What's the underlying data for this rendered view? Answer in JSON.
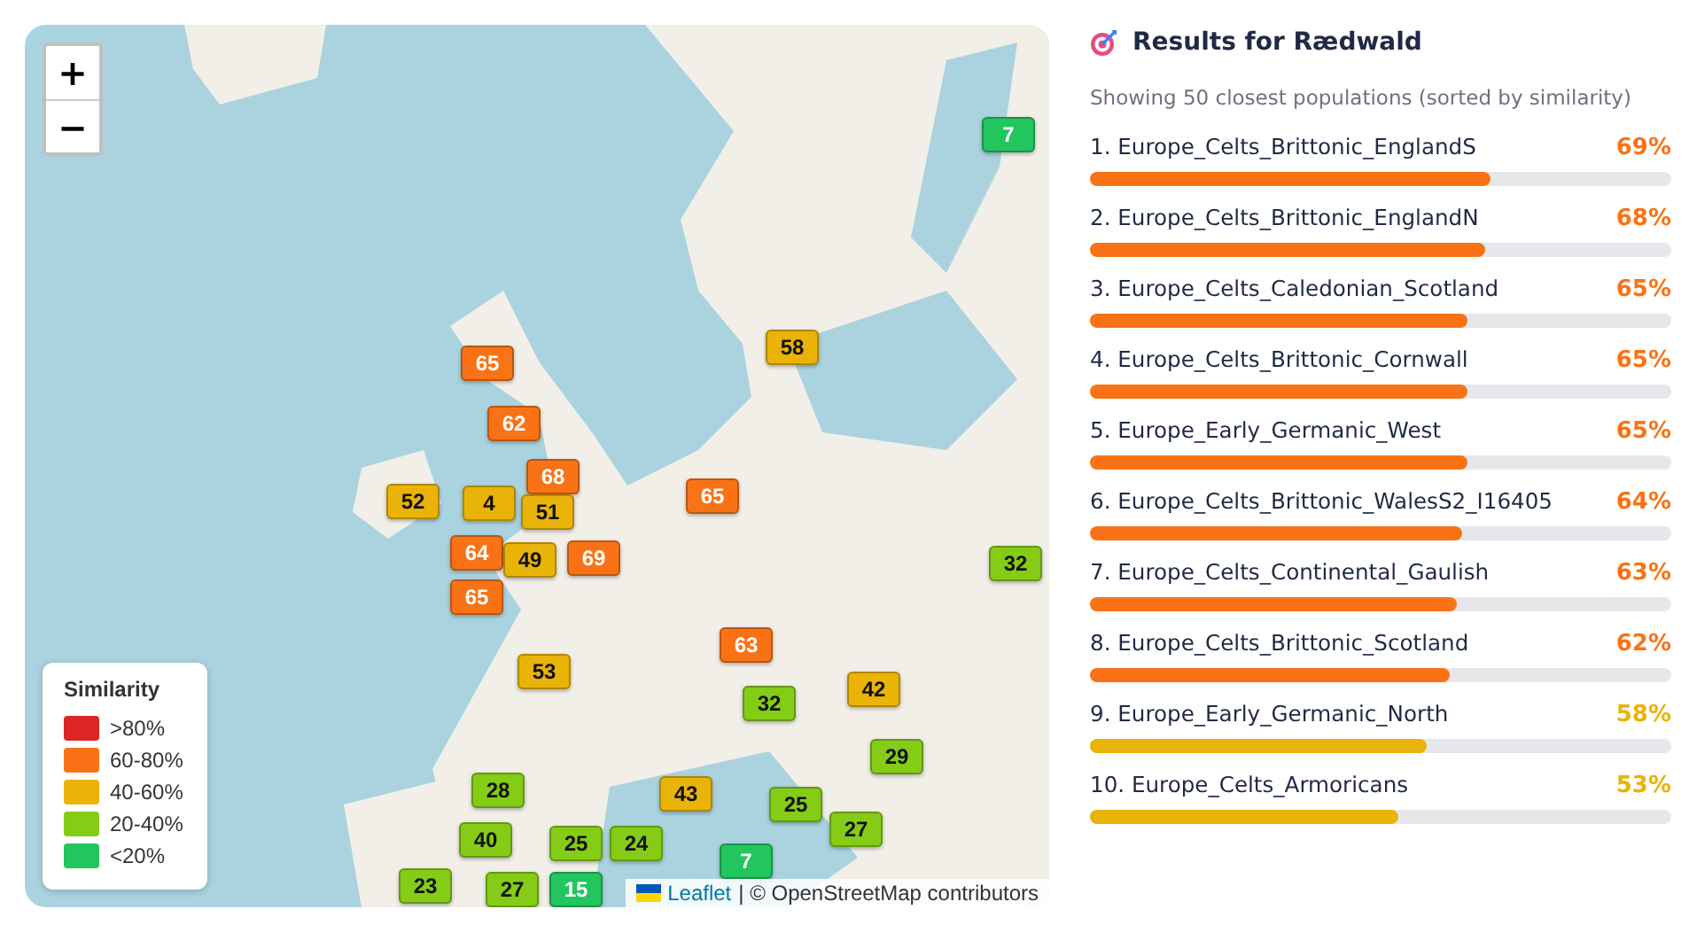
{
  "map": {
    "zoom_in": "+",
    "zoom_out": "−",
    "markers": [
      {
        "value": "65",
        "color": "#f97316"
      },
      {
        "value": "62",
        "color": "#f97316"
      },
      {
        "value": "68",
        "color": "#f97316"
      },
      {
        "value": "52",
        "color": "#eab308"
      },
      {
        "value": "4",
        "color": "#eab308"
      },
      {
        "value": "51",
        "color": "#eab308"
      },
      {
        "value": "64",
        "color": "#f97316"
      },
      {
        "value": "49",
        "color": "#eab308"
      },
      {
        "value": "69",
        "color": "#f97316"
      },
      {
        "value": "65",
        "color": "#f97316"
      },
      {
        "value": "53",
        "color": "#eab308"
      },
      {
        "value": "58",
        "color": "#eab308"
      },
      {
        "value": "7",
        "color": "#22c55e"
      },
      {
        "value": "65",
        "color": "#f97316"
      },
      {
        "value": "63",
        "color": "#f97316"
      },
      {
        "value": "32",
        "color": "#84cc16"
      },
      {
        "value": "42",
        "color": "#eab308"
      },
      {
        "value": "29",
        "color": "#84cc16"
      },
      {
        "value": "43",
        "color": "#eab308"
      },
      {
        "value": "32",
        "color": "#84cc16"
      },
      {
        "value": "28",
        "color": "#84cc16"
      },
      {
        "value": "40",
        "color": "#84cc16"
      },
      {
        "value": "23",
        "color": "#84cc16"
      },
      {
        "value": "24",
        "color": "#84cc16"
      },
      {
        "value": "27",
        "color": "#84cc16"
      },
      {
        "value": "25",
        "color": "#84cc16"
      },
      {
        "value": "27",
        "color": "#84cc16"
      },
      {
        "value": "7",
        "color": "#22c55e"
      },
      {
        "value": "25",
        "color": "#84cc16"
      },
      {
        "value": "15",
        "color": "#22c55e"
      }
    ],
    "legend": {
      "title": "Similarity",
      "items": [
        {
          "label": ">80%",
          "color": "#dc2626"
        },
        {
          "label": "60-80%",
          "color": "#f97316"
        },
        {
          "label": "40-60%",
          "color": "#eab308"
        },
        {
          "label": "20-40%",
          "color": "#84cc16"
        },
        {
          "label": "<20%",
          "color": "#22c55e"
        }
      ]
    },
    "attribution": {
      "link": "Leaflet",
      "text": "| © OpenStreetMap contributors"
    }
  },
  "results": {
    "title": "Results for Rædwald",
    "subtitle": "Showing 50 closest populations (sorted by similarity)",
    "rows": [
      {
        "label": "1. Europe_Celts_Brittonic_EnglandS",
        "percent": "69%",
        "level": 0.69,
        "color": "#f97316"
      },
      {
        "label": "2. Europe_Celts_Brittonic_EnglandN",
        "percent": "68%",
        "level": 0.68,
        "color": "#f97316"
      },
      {
        "label": "3. Europe_Celts_Caledonian_Scotland",
        "percent": "65%",
        "level": 0.65,
        "color": "#f97316"
      },
      {
        "label": "4. Europe_Celts_Brittonic_Cornwall",
        "percent": "65%",
        "level": 0.65,
        "color": "#f97316"
      },
      {
        "label": "5. Europe_Early_Germanic_West",
        "percent": "65%",
        "level": 0.65,
        "color": "#f97316"
      },
      {
        "label": "6. Europe_Celts_Brittonic_WalesS2_I16405",
        "percent": "64%",
        "level": 0.64,
        "color": "#f97316"
      },
      {
        "label": "7. Europe_Celts_Continental_Gaulish",
        "percent": "63%",
        "level": 0.63,
        "color": "#f97316"
      },
      {
        "label": "8. Europe_Celts_Brittonic_Scotland",
        "percent": "62%",
        "level": 0.62,
        "color": "#f97316"
      },
      {
        "label": "9. Europe_Early_Germanic_North",
        "percent": "58%",
        "level": 0.58,
        "color": "#eab308"
      },
      {
        "label": "10. Europe_Celts_Armoricans",
        "percent": "53%",
        "level": 0.53,
        "color": "#eab308"
      }
    ]
  }
}
